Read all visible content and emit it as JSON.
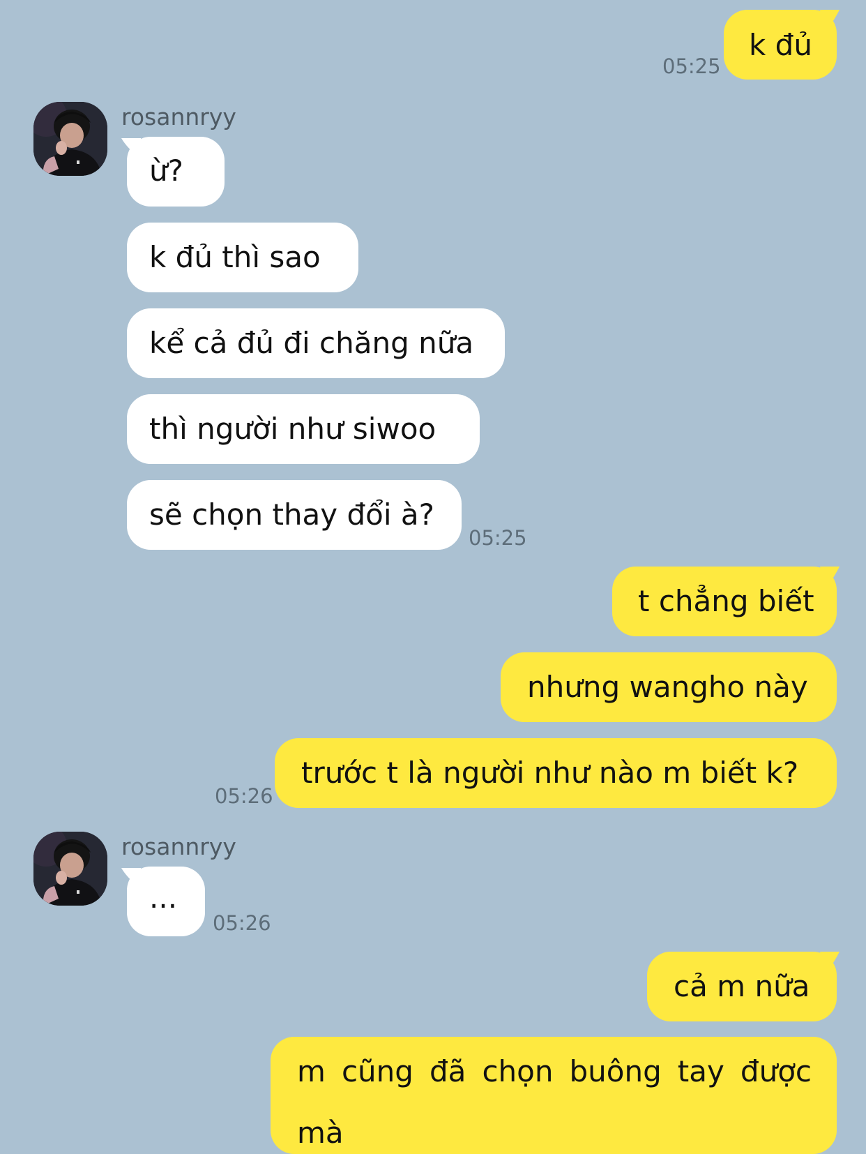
{
  "contact": {
    "name": "rosannryy",
    "avatar_icon": "profile-photo-avatar"
  },
  "colors": {
    "background": "#abc1d2",
    "my_bubble": "#fee940",
    "their_bubble": "#ffffff",
    "timestamp": "#5d6d79"
  },
  "messages": [
    {
      "side": "me",
      "text": "k đủ",
      "time": "05:25"
    },
    {
      "side": "them",
      "sender": "rosannryy",
      "text": "ừ?"
    },
    {
      "side": "them",
      "text": "k đủ thì sao"
    },
    {
      "side": "them",
      "text": "kể cả đủ đi chăng nữa"
    },
    {
      "side": "them",
      "text": "thì người như siwoo"
    },
    {
      "side": "them",
      "text": "sẽ chọn thay đổi à?",
      "time": "05:25"
    },
    {
      "side": "me",
      "text": "t chẳng biết"
    },
    {
      "side": "me",
      "text": "nhưng wangho này"
    },
    {
      "side": "me",
      "text": "trước t là người như nào m biết k?",
      "time": "05:26"
    },
    {
      "side": "them",
      "sender": "rosannryy",
      "text": "...",
      "time": "05:26"
    },
    {
      "side": "me",
      "text": "cả m nữa"
    },
    {
      "side": "me",
      "text_line1": "m cũng đã chọn buông tay được",
      "text_line2": "mà"
    }
  ]
}
